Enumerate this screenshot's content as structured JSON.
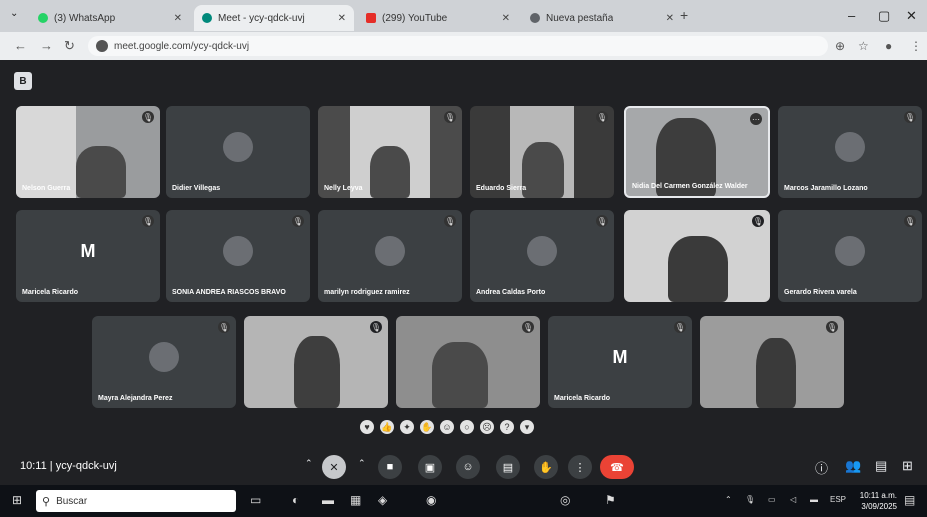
{
  "browser": {
    "tabs": [
      {
        "label": "(3) WhatsApp",
        "icon": "whatsapp-icon"
      },
      {
        "label": "Meet - ycy-qdck-uvj",
        "icon": "meet-icon",
        "active": true
      },
      {
        "label": "(299) YouTube",
        "icon": "youtube-icon"
      },
      {
        "label": "Nueva pestaña",
        "icon": "chrome-icon"
      }
    ],
    "url": "meet.google.com/ycy-qdck-uvj"
  },
  "participants": [
    {
      "name": "Nelson Guerra",
      "type": "video"
    },
    {
      "name": "Didier Villegas",
      "type": "avatar"
    },
    {
      "name": "Nelly Leyva",
      "type": "video"
    },
    {
      "name": "Eduardo Sierra",
      "type": "video"
    },
    {
      "name": "Nidia Del Carmen González Walder",
      "type": "video"
    },
    {
      "name": "Marcos Jaramillo Lozano",
      "type": "avatar"
    },
    {
      "name": "Maricela Ricardo",
      "type": "letter",
      "letter": "M"
    },
    {
      "name": "SONIA ANDREA RIASCOS BRAVO",
      "type": "avatar"
    },
    {
      "name": "marilyn rodriguez ramirez",
      "type": "avatar"
    },
    {
      "name": "Andrea Caldas Porto",
      "type": "avatar"
    },
    {
      "name": "",
      "type": "video"
    },
    {
      "name": "Gerardo Rivera varela",
      "type": "avatar"
    },
    {
      "name": "Mayra Alejandra Perez",
      "type": "avatar"
    },
    {
      "name": "",
      "type": "video"
    },
    {
      "name": "",
      "type": "video"
    },
    {
      "name": "Maricela Ricardo",
      "type": "letter",
      "letter": "M"
    },
    {
      "name": "",
      "type": "video"
    }
  ],
  "meeting": {
    "time": "10:11",
    "separator": "|",
    "code": "ycy-qdck-uvj"
  },
  "taskbar": {
    "search_placeholder": "Buscar",
    "language": "ESP",
    "clock_time": "10:11 a.m.",
    "clock_date": "3/09/2025"
  }
}
